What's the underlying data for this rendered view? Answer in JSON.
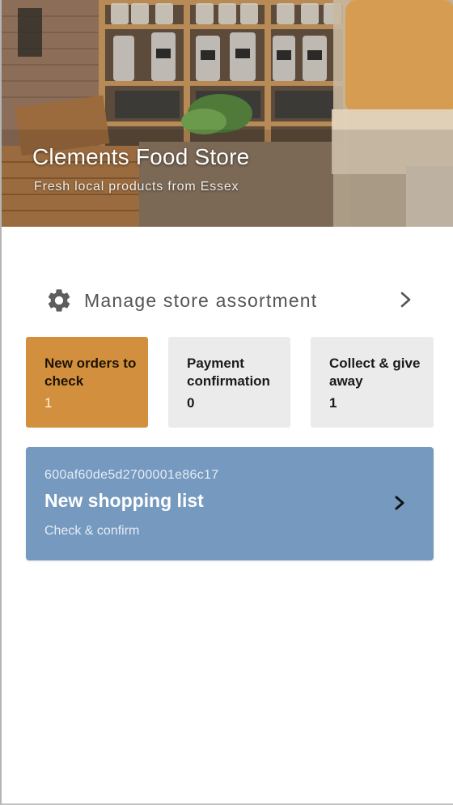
{
  "store": {
    "title": "Clements Food Store",
    "subtitle": "Fresh local products from Essex"
  },
  "manage": {
    "label": "Manage store assortment",
    "icon": "gear-icon",
    "chevron_icon": "chevron-right-icon"
  },
  "tiles": [
    {
      "label": "New orders to check",
      "count": "1",
      "color": "#d28f3d"
    },
    {
      "label": "Payment confirmation",
      "count": "0",
      "color": "#ebebeb"
    },
    {
      "label": "Collect & give away",
      "count": "1",
      "color": "#ebebeb"
    }
  ],
  "order": {
    "id": "600af60de5d2700001e86c17",
    "title": "New shopping list",
    "subtitle": "Check & confirm",
    "color": "#7599bf",
    "chevron_icon": "chevron-right-icon"
  }
}
